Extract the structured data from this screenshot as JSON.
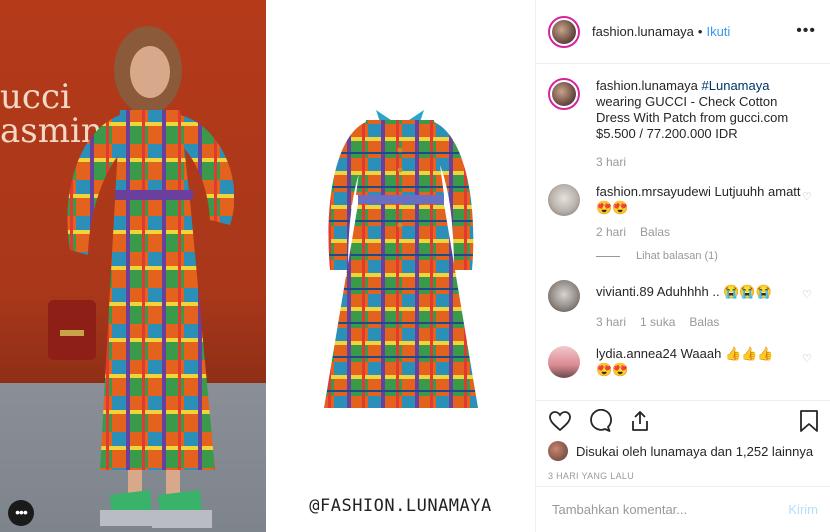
{
  "media": {
    "wall_text": "ucci\nasmine",
    "watermark": "@FASHION.LUNAMAYA",
    "more_glyph": "•••"
  },
  "header": {
    "username": "fashion.lunamaya",
    "separator": "•",
    "follow_label": "Ikuti",
    "more_glyph": "•••"
  },
  "caption": {
    "username": "fashion.lunamaya",
    "hashtag": "#Lunamaya",
    "text": "wearing GUCCI - Check Cotton Dress With Patch from gucci.com $5.500 / 77.200.000 IDR",
    "time": "3 hari"
  },
  "comments": [
    {
      "username": "fashion.mrsayudewi",
      "text": "Lutjuuhh amatt",
      "emoji": "😍😍",
      "time": "2 hari",
      "reply_label": "Balas",
      "view_replies": "Lihat balasan (1)"
    },
    {
      "username": "vivianti.89",
      "text": "Aduhhhh ..",
      "emoji": "😭😭😭",
      "time": "3 hari",
      "likes": "1 suka",
      "reply_label": "Balas"
    },
    {
      "username": "lydia.annea24",
      "text": "Waaah",
      "emoji": "👍👍👍",
      "emoji2": "😍😍",
      "time": "",
      "reply_label": ""
    }
  ],
  "actions": {
    "likes_prefix": "Disukai oleh",
    "likes_user": "lunamaya",
    "likes_and": "dan",
    "likes_count": "1,252 lainnya",
    "timestamp": "3 HARI YANG LALU"
  },
  "comment_box": {
    "placeholder": "Tambahkan komentar...",
    "post_label": "Kirim"
  },
  "colors": {
    "link": "#3897f0",
    "hashtag": "#003569",
    "muted": "#999999",
    "text": "#262626",
    "post_disabled": "#b2dffc"
  },
  "icons": [
    "heart-icon",
    "comment-icon",
    "share-icon",
    "bookmark-icon",
    "more-icon"
  ]
}
